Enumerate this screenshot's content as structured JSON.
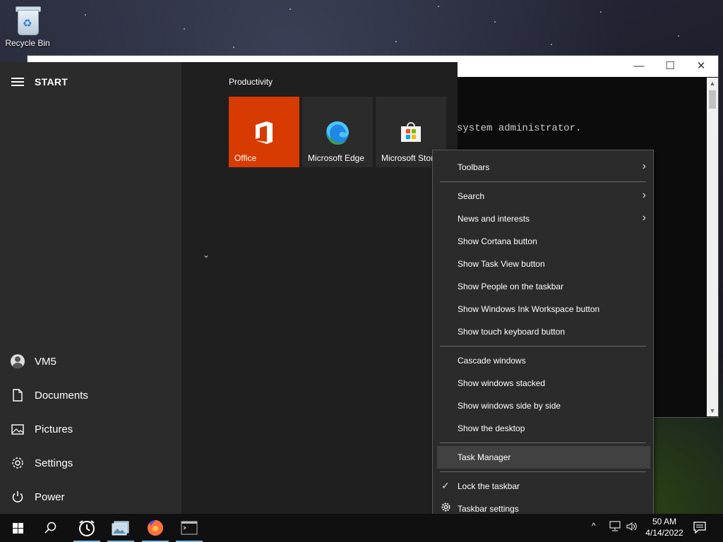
{
  "desktop": {
    "recycle_bin_label": "Recycle Bin"
  },
  "console": {
    "text": "system administrator."
  },
  "start_menu": {
    "title": "START",
    "group_title": "Productivity",
    "user": "VM5",
    "rail_items": [
      {
        "label": "Documents",
        "icon": "document-icon"
      },
      {
        "label": "Pictures",
        "icon": "pictures-icon"
      },
      {
        "label": "Settings",
        "icon": "gear-icon"
      },
      {
        "label": "Power",
        "icon": "power-icon"
      }
    ],
    "tiles": [
      {
        "label": "Office",
        "color": "#d83b01",
        "icon": "office-icon"
      },
      {
        "label": "Microsoft Edge",
        "color": "#2b2b2b",
        "icon": "edge-icon"
      },
      {
        "label": "Microsoft Store",
        "color": "#2b2b2b",
        "icon": "store-icon"
      }
    ]
  },
  "context_menu": {
    "items": {
      "toolbars": "Toolbars",
      "search": "Search",
      "news": "News and interests",
      "cortana": "Show Cortana button",
      "task_view": "Show Task View button",
      "people": "Show People on the taskbar",
      "ink": "Show Windows Ink Workspace button",
      "touch_keyboard": "Show touch keyboard button",
      "cascade": "Cascade windows",
      "stacked": "Show windows stacked",
      "side_by_side": "Show windows side by side",
      "show_desktop": "Show the desktop",
      "task_manager": "Task Manager",
      "lock_taskbar": "Lock the taskbar",
      "taskbar_settings": "Taskbar settings"
    },
    "lock_checked": true,
    "highlighted": "Task Manager"
  },
  "taskbar": {
    "time": "50 AM",
    "date": "4/14/2022",
    "accent_color": "#76b9ed"
  }
}
